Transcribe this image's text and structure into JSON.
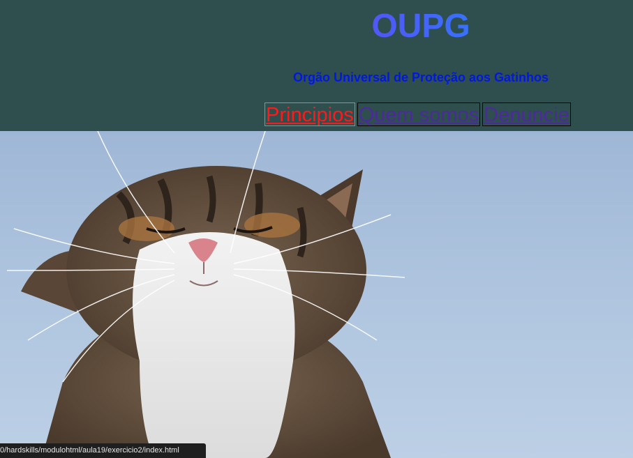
{
  "header": {
    "title": "OUPG",
    "subtitle": "Orgão Universal de Proteção aos Gatinhos",
    "background": "#2f4f4f",
    "title_gradient": [
      "#6a3df0",
      "#1f8bff"
    ],
    "subtitle_color": "#0018e0"
  },
  "nav": {
    "links": [
      {
        "label": "Principios",
        "state": "active",
        "color": "#ff1a1a"
      },
      {
        "label": "Quem somos",
        "state": "visited",
        "color": "#4b2a9a"
      },
      {
        "label": "Denuncie",
        "state": "visited",
        "color": "#4b2a9a"
      }
    ]
  },
  "hero": {
    "image_subject": "cat-photo"
  },
  "status_bar": {
    "url": "0/hardskills/modulohtml/aula19/exercicio2/index.html"
  }
}
